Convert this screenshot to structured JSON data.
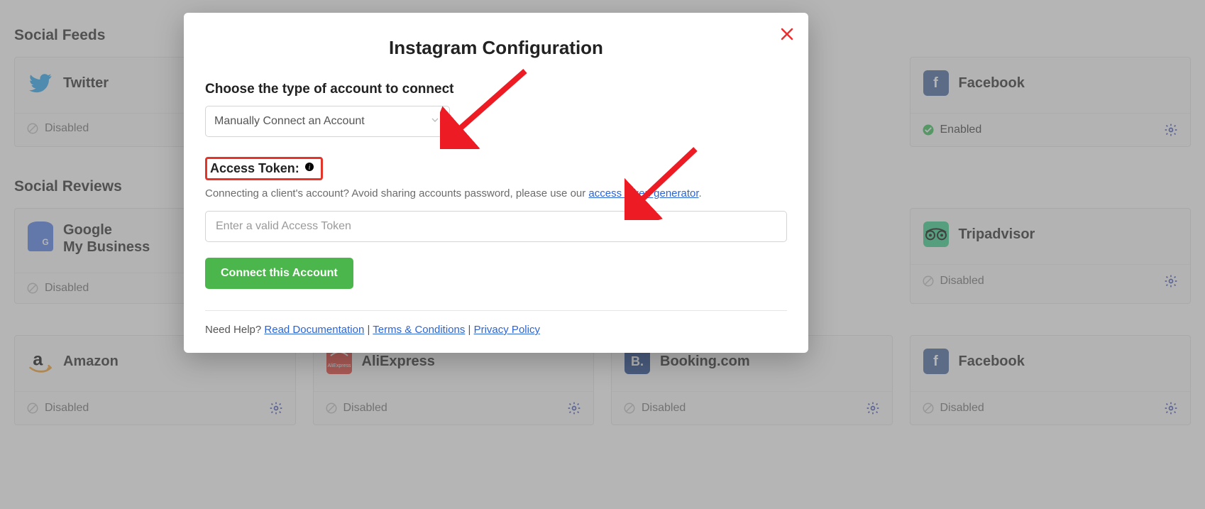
{
  "sections": {
    "feeds_title": "Social Feeds",
    "reviews_title": "Social Reviews"
  },
  "status": {
    "disabled": "Disabled",
    "enabled": "Enabled"
  },
  "cards": {
    "twitter": "Twitter",
    "facebook": "Facebook",
    "gmb_line1": "Google",
    "gmb_line2": "My Business",
    "tripadvisor": "Tripadvisor",
    "amazon": "Amazon",
    "aliexpress": "AliExpress",
    "booking": "Booking.com"
  },
  "modal": {
    "title": "Instagram Configuration",
    "choose_label": "Choose the type of account to connect",
    "select_value": "Manually Connect an Account",
    "access_token_label": "Access Token:",
    "hint_prefix": "Connecting a client's account? Avoid sharing accounts password, please use our ",
    "hint_link": "access token generator",
    "hint_suffix": ".",
    "token_placeholder": "Enter a valid Access Token",
    "connect_btn": "Connect this Account",
    "need_help": "Need Help? ",
    "doc_link": "Read Documentation",
    "sep": " | ",
    "terms_link": "Terms & Conditions",
    "privacy_link": "Privacy Policy"
  },
  "brand_text": {
    "fb": "f",
    "gmb": "G",
    "booking": "B.",
    "ali": "AliExpress"
  }
}
